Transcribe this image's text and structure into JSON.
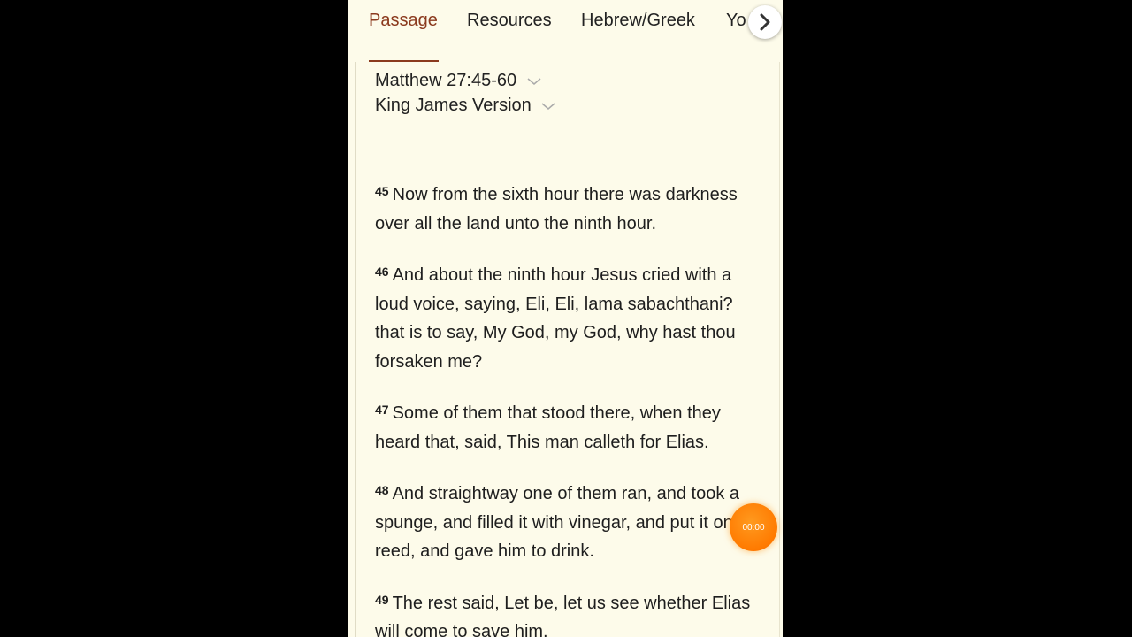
{
  "colors": {
    "background": "#000000",
    "page": "#FDFBEA",
    "accent": "#8B3A1E",
    "text": "#1E1E1E",
    "audio": "#FF7A00"
  },
  "tabs": [
    {
      "label": "Passage",
      "active": true
    },
    {
      "label": "Resources",
      "active": false
    },
    {
      "label": "Hebrew/Greek",
      "active": false
    },
    {
      "label": "Yo",
      "active": false
    }
  ],
  "tab_next_icon": "chevron-right-icon",
  "passage_selector": {
    "label": "Matthew 27:45-60",
    "icon": "chevron-down-icon"
  },
  "version_selector": {
    "label": "King James Version",
    "icon": "chevron-down-icon"
  },
  "verses": [
    {
      "num": "45",
      "text": "Now from the sixth hour there was darkness over all the land unto the ninth hour."
    },
    {
      "num": "46",
      "text": "And about the ninth hour Jesus cried with a loud voice, saying, Eli, Eli, lama sabachthani? that is to say, My God, my God, why hast thou forsaken me?"
    },
    {
      "num": "47",
      "text": "Some of them that stood there, when they heard that, said, This man calleth for Elias."
    },
    {
      "num": "48",
      "text": "And straightway one of them ran, and took a spunge, and filled it with vinegar, and put it on a reed, and gave him to drink."
    },
    {
      "num": "49",
      "text": "The rest said, Let be, let us see whether Elias will come to save him."
    }
  ],
  "audio_button": {
    "time": "00:00"
  }
}
